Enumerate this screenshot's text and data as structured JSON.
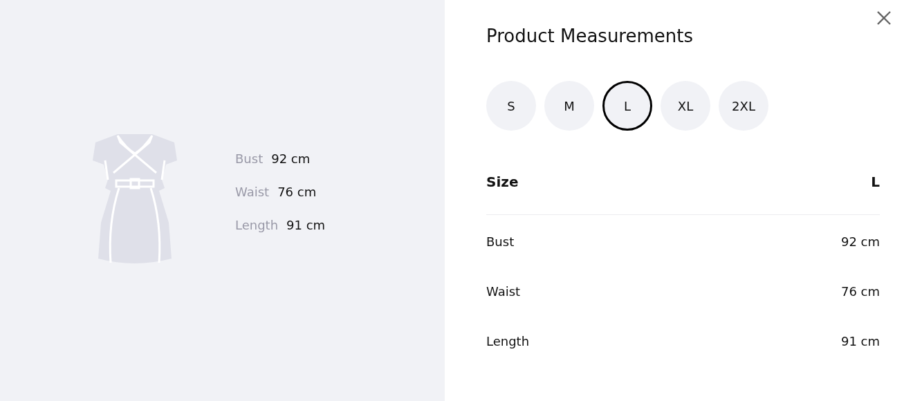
{
  "preview": {
    "measurements": [
      {
        "label": "Bust",
        "value": "92 cm"
      },
      {
        "label": "Waist",
        "value": "76 cm"
      },
      {
        "label": "Length",
        "value": "91 cm"
      }
    ]
  },
  "title": "Product Measurements",
  "sizes": [
    {
      "label": "S",
      "selected": false
    },
    {
      "label": "M",
      "selected": false
    },
    {
      "label": "L",
      "selected": true
    },
    {
      "label": "XL",
      "selected": false
    },
    {
      "label": "2XL",
      "selected": false
    }
  ],
  "table": {
    "header": {
      "label": "Size",
      "value": "L"
    },
    "rows": [
      {
        "label": "Bust",
        "value": "92 cm"
      },
      {
        "label": "Waist",
        "value": "76 cm"
      },
      {
        "label": "Length",
        "value": "91 cm"
      }
    ]
  }
}
